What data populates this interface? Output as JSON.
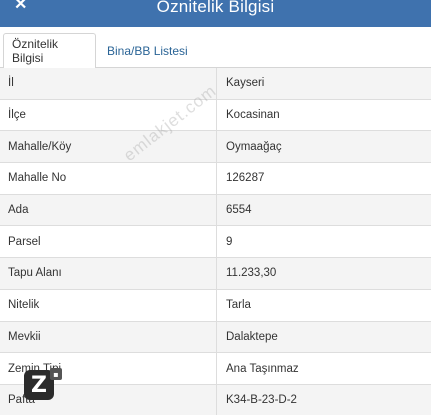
{
  "header": {
    "title": "Öznitelik Bilgisi",
    "close_glyph": "✕"
  },
  "tabs": [
    {
      "label": "Öznitelik Bilgisi",
      "active": true
    },
    {
      "label": "Bina/BB Listesi",
      "active": false
    }
  ],
  "rows": [
    {
      "label": "İl",
      "value": "Kayseri"
    },
    {
      "label": "İlçe",
      "value": "Kocasinan"
    },
    {
      "label": "Mahalle/Köy",
      "value": "Oymaağaç"
    },
    {
      "label": "Mahalle No",
      "value": "126287"
    },
    {
      "label": "Ada",
      "value": "6554"
    },
    {
      "label": "Parsel",
      "value": "9"
    },
    {
      "label": "Tapu Alanı",
      "value": "11.233,30"
    },
    {
      "label": "Nitelik",
      "value": "Tarla"
    },
    {
      "label": "Mevkii",
      "value": "Dalaktepe"
    },
    {
      "label": "Zemin Tipi",
      "value": "Ana Taşınmaz"
    },
    {
      "label": "Pafta",
      "value": "K34-B-23-D-2"
    }
  ],
  "watermark": "emlakjet.com",
  "logo": {
    "letter": "Z",
    "icon": "app-logo-icon"
  },
  "colors": {
    "header_bg": "#3f72ae",
    "link": "#2a6496",
    "stripe": "#f4f4f4"
  }
}
